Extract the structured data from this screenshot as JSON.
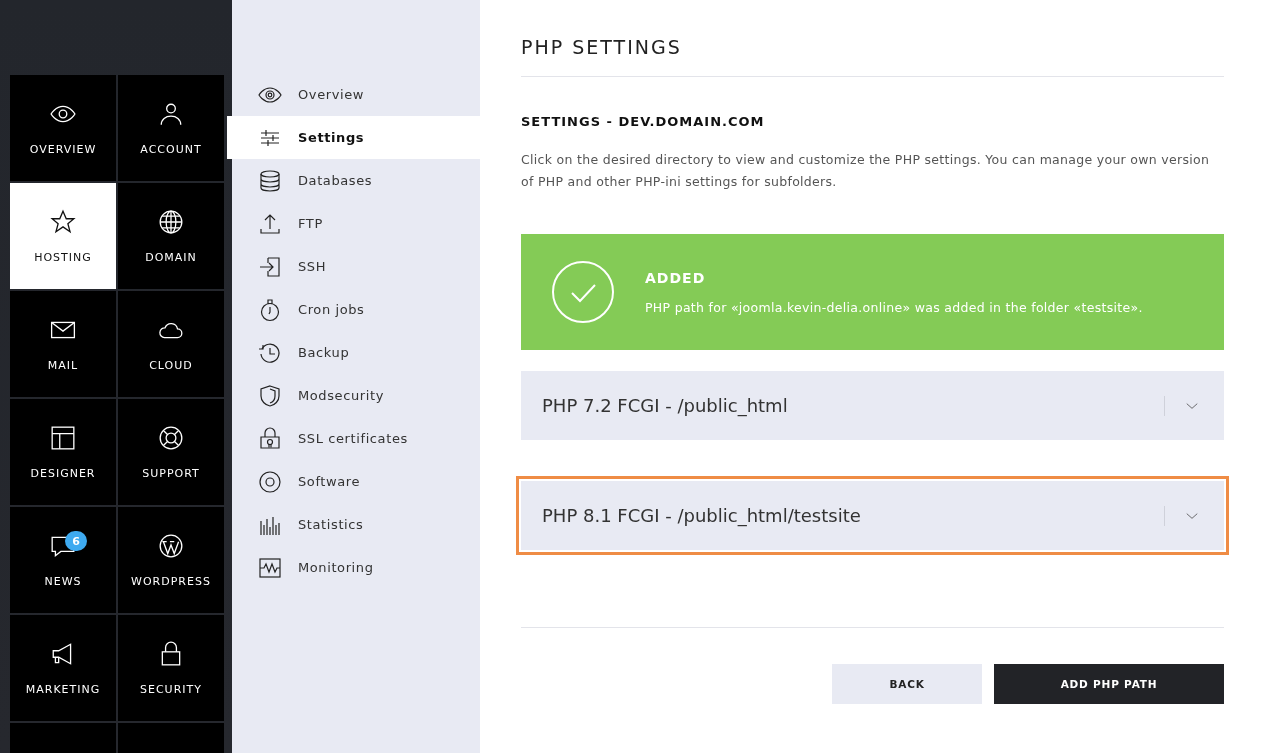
{
  "main_nav": [
    {
      "label": "OVERVIEW",
      "selected": false
    },
    {
      "label": "ACCOUNT",
      "selected": false
    },
    {
      "label": "HOSTING",
      "selected": true
    },
    {
      "label": "DOMAIN",
      "selected": false
    },
    {
      "label": "MAIL",
      "selected": false
    },
    {
      "label": "CLOUD",
      "selected": false
    },
    {
      "label": "DESIGNER",
      "selected": false
    },
    {
      "label": "SUPPORT",
      "selected": false
    },
    {
      "label": "NEWS",
      "selected": false,
      "badge": "6"
    },
    {
      "label": "WORDPRESS",
      "selected": false
    },
    {
      "label": "MARKETING",
      "selected": false
    },
    {
      "label": "SECURITY",
      "selected": false
    }
  ],
  "sub_nav": [
    {
      "label": "Overview",
      "selected": false
    },
    {
      "label": "Settings",
      "selected": true
    },
    {
      "label": "Databases",
      "selected": false
    },
    {
      "label": "FTP",
      "selected": false
    },
    {
      "label": "SSH",
      "selected": false
    },
    {
      "label": "Cron jobs",
      "selected": false
    },
    {
      "label": "Backup",
      "selected": false
    },
    {
      "label": "Modsecurity",
      "selected": false
    },
    {
      "label": "SSL certificates",
      "selected": false
    },
    {
      "label": "Software",
      "selected": false
    },
    {
      "label": "Statistics",
      "selected": false
    },
    {
      "label": "Monitoring",
      "selected": false
    }
  ],
  "page": {
    "title": "PHP SETTINGS",
    "subtitle": "SETTINGS - DEV.DOMAIN.COM",
    "description": "Click on the desired directory to view and customize the PHP settings. You can manage your own version of PHP and other PHP-ini settings for subfolders."
  },
  "alert": {
    "title": "ADDED",
    "message": "PHP path for «joomla.kevin-delia.online» was added in the folder «testsite»."
  },
  "php_paths": [
    {
      "label": "PHP 7.2 FCGI - /public_html",
      "highlighted": false
    },
    {
      "label": "PHP 8.1 FCGI - /public_html/testsite",
      "highlighted": true
    }
  ],
  "buttons": [
    {
      "label": "BACK",
      "kind": "secondary"
    },
    {
      "label": "ADD PHP PATH",
      "kind": "primary"
    }
  ]
}
